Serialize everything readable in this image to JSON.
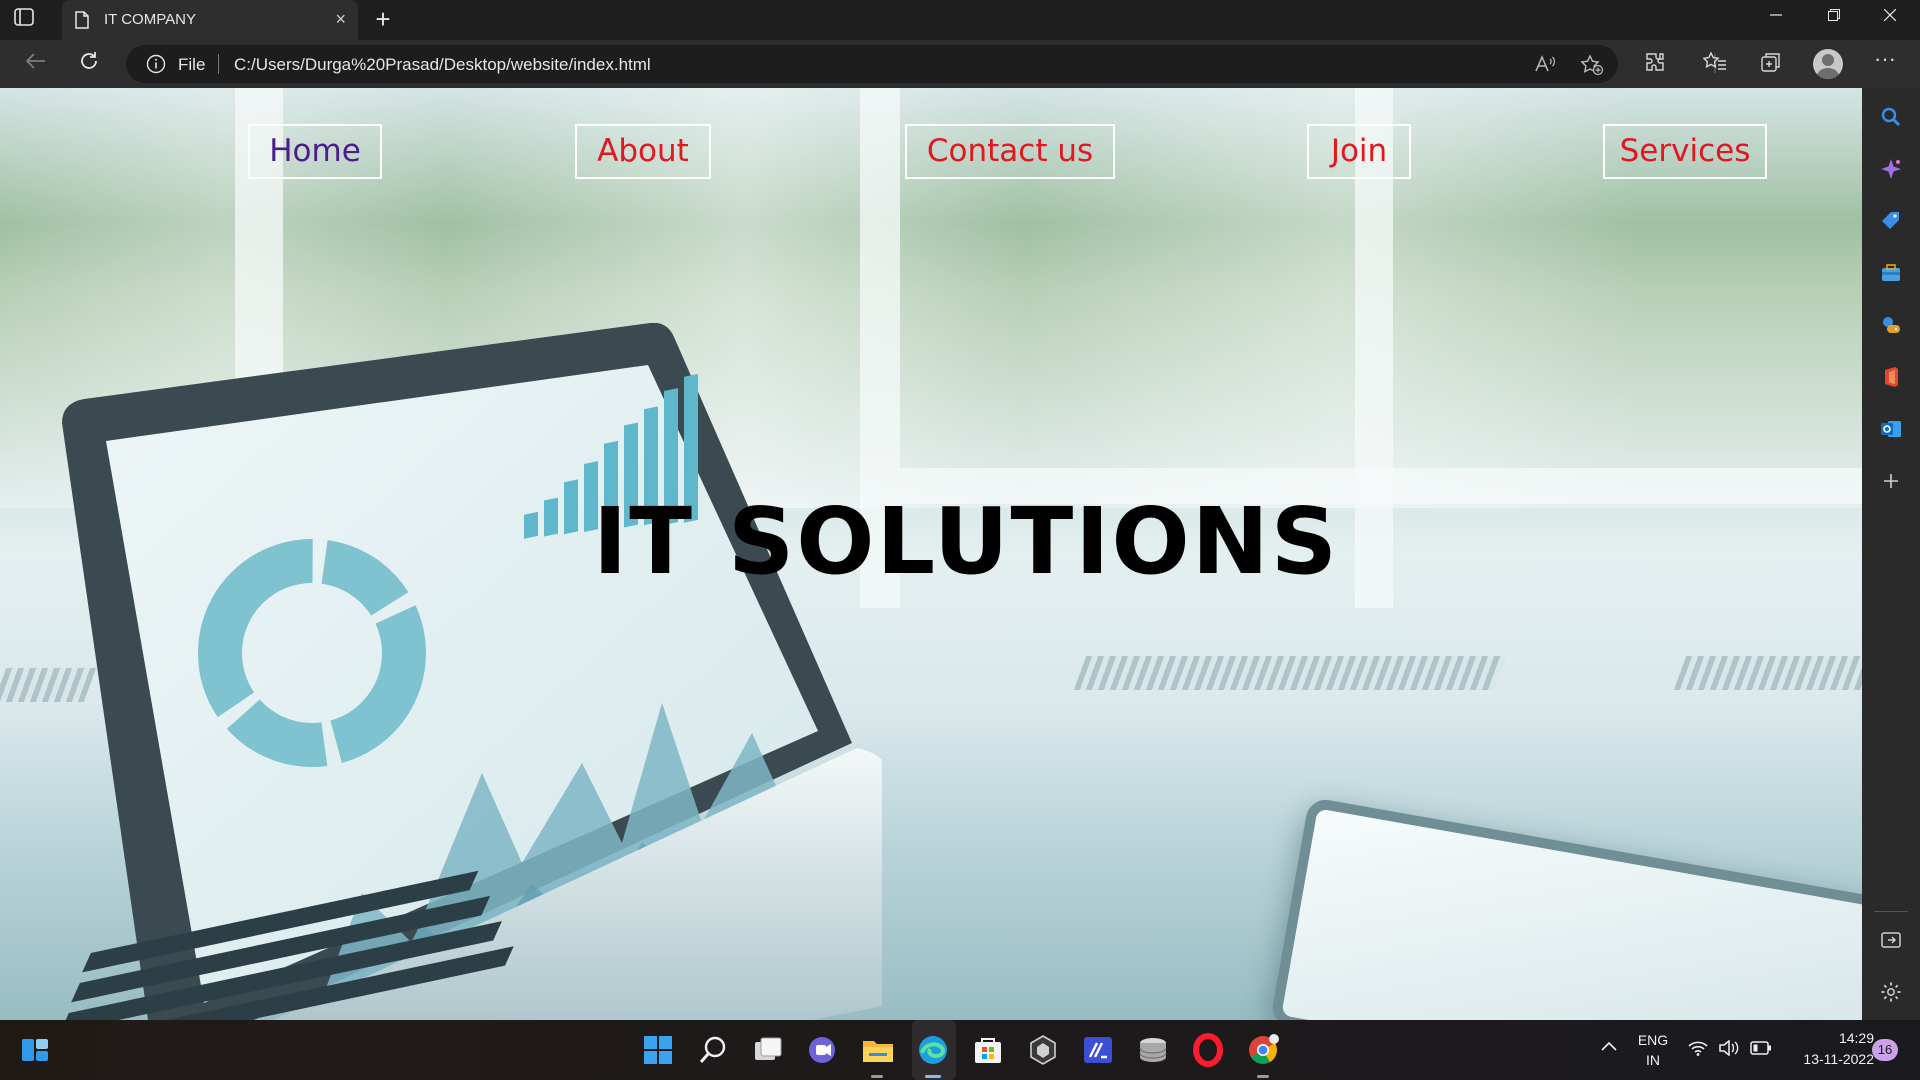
{
  "browser": {
    "tab_title": "IT COMPANY",
    "tab_close": "×",
    "new_tab": "+",
    "address_scheme": "File",
    "address_url": "C:/Users/Durga%20Prasad/Desktop/website/index.html",
    "window_controls": {
      "minimize": "—",
      "restore": "❐",
      "close": "✕"
    },
    "menu": "···",
    "read_aloud": "A",
    "icons": [
      "page-icon",
      "back-icon",
      "refresh-icon",
      "info-icon",
      "read-aloud-icon",
      "add-favorite-icon",
      "extensions-icon",
      "favorites-icon",
      "collections-icon",
      "profile-icon",
      "more-icon"
    ]
  },
  "page": {
    "nav": [
      {
        "label": "Home",
        "color": "#4b1d8a"
      },
      {
        "label": "About",
        "color": "#e0181f"
      },
      {
        "label": "Contact us",
        "color": "#e0181f"
      },
      {
        "label": "Join",
        "color": "#e0181f"
      },
      {
        "label": "Services",
        "color": "#e0181f"
      }
    ],
    "hero_title": "IT SOLUTIONS"
  },
  "sidebar": {
    "icons": [
      "search-icon",
      "copilot-icon",
      "shopping-tag-icon",
      "tools-icon",
      "games-icon",
      "office-icon",
      "outlook-icon",
      "add-icon",
      "hide-sidebar-icon",
      "settings-icon"
    ]
  },
  "taskbar": {
    "apps": [
      "widgets-icon",
      "start-icon",
      "search-icon",
      "task-view-icon",
      "teams-chat-icon",
      "file-explorer-icon",
      "edge-icon",
      "store-icon",
      "unity-icon",
      "vscode-like-icon",
      "disk-icon",
      "opera-icon",
      "chrome-icon"
    ],
    "tray": {
      "language_line1": "ENG",
      "language_line2": "IN",
      "time": "14:29",
      "date": "13-11-2022",
      "notification_count": "16"
    }
  },
  "colors": {
    "nav_home": "#4b1d8a",
    "nav_other": "#e0181f",
    "edge_accent": "#2f7de0"
  }
}
